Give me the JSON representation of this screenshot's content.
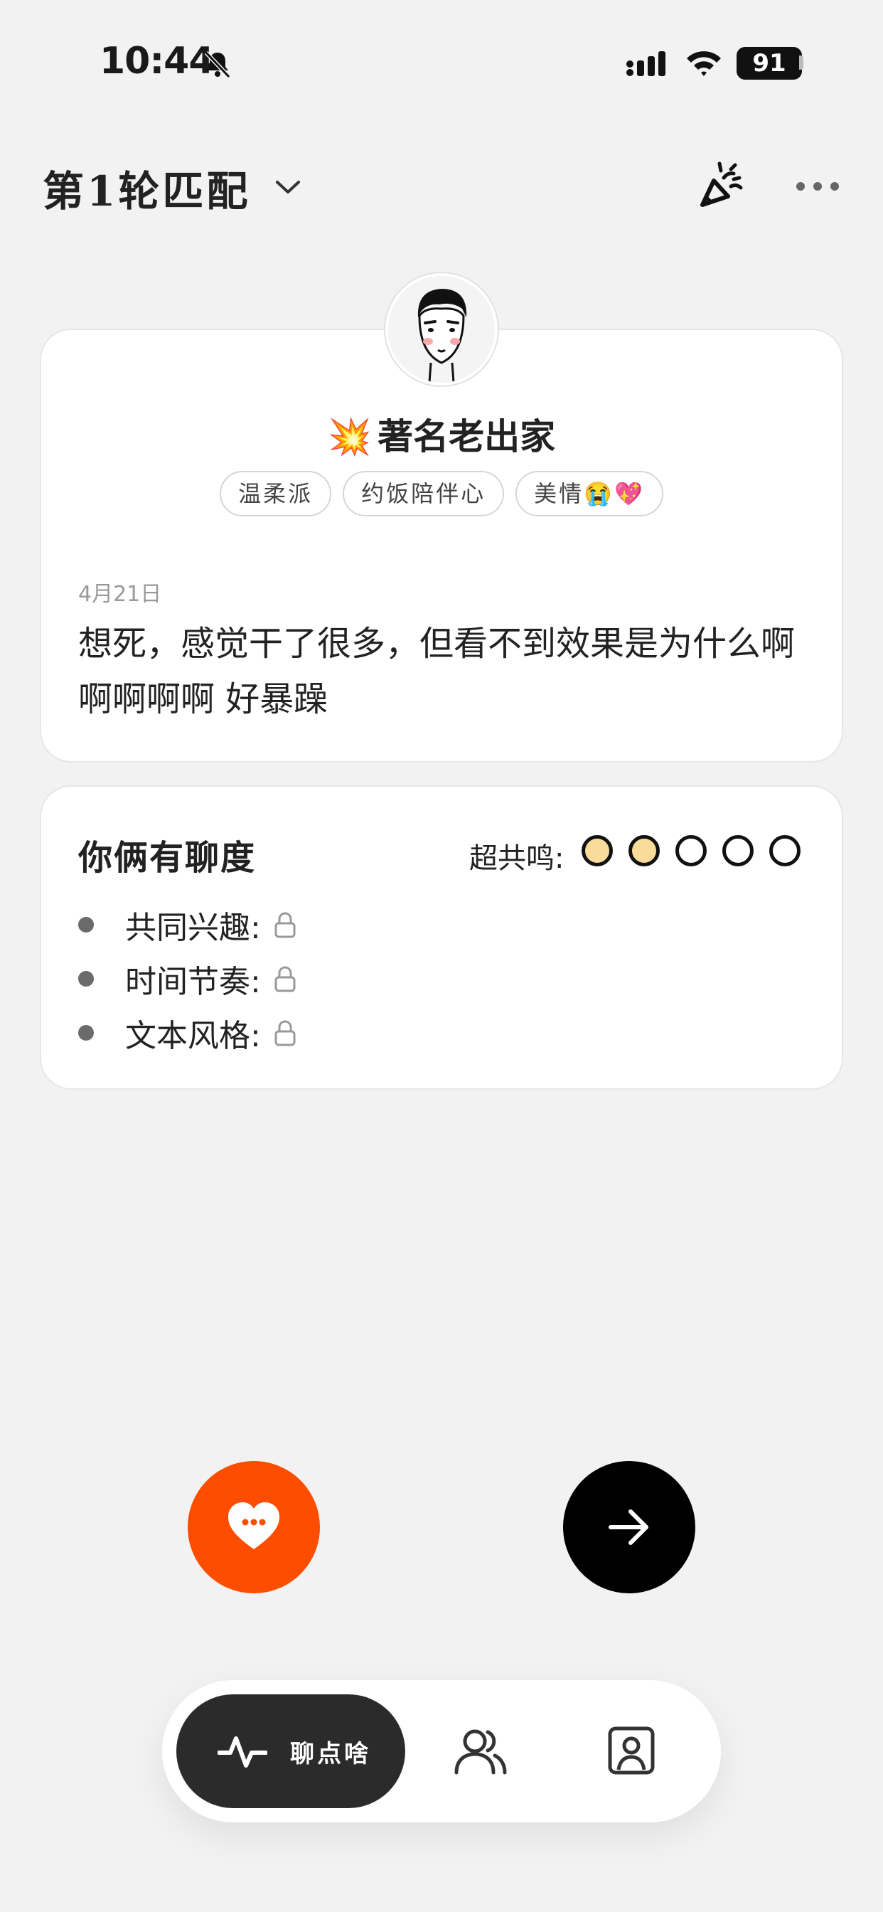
{
  "status_bar": {
    "time": "10:44",
    "battery": "91"
  },
  "header": {
    "title": "第1轮匹配"
  },
  "profile": {
    "emoji": "💥",
    "nickname": "著名老出家",
    "tags": [
      "温柔派",
      "约饭陪伴心",
      "美情😭💖"
    ],
    "post_date": "4月21日",
    "post_text": "想死，感觉干了很多，但看不到效果是为什么啊啊啊啊啊 好暴躁"
  },
  "chat_degree": {
    "title": "你俩有聊度",
    "resonance_label": "超共鸣:",
    "resonance_level": 2,
    "resonance_max": 5,
    "resonance_fill_color": "#f9dc9a",
    "items": [
      {
        "label": "共同兴趣:"
      },
      {
        "label": "时间节奏:"
      },
      {
        "label": "文本风格:"
      }
    ]
  },
  "actions": {
    "like_color": "#ff4d00",
    "next_color": "#000000"
  },
  "bottom_nav": {
    "active_label": "聊点啥",
    "icons": [
      "pulse-icon",
      "friends-icon",
      "profile-icon"
    ]
  }
}
